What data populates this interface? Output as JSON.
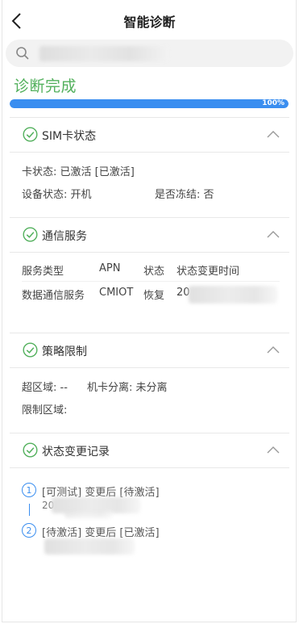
{
  "header": {
    "title": "智能诊断"
  },
  "search": {
    "value": "",
    "placeholder": ""
  },
  "diagnosis": {
    "status": "诊断完成",
    "progress_text": "100%",
    "progress_fraction": 1.0
  },
  "sections": {
    "sim": {
      "title": "SIM卡状态",
      "card_status": "卡状态: 已激活 [已激活]",
      "device_status": "设备状态: 开机",
      "frozen": "是否冻结: 否"
    },
    "comm": {
      "title": "通信服务",
      "columns": [
        "服务类型",
        "APN",
        "状态",
        "状态变更时间"
      ],
      "rows": [
        {
          "service_type": "数据通信服务",
          "apn": "CMIOT",
          "status": "恢复",
          "change_time": "20"
        }
      ]
    },
    "policy": {
      "title": "策略限制",
      "out_of_region": "超区域: --",
      "separation": "机卡分离: 未分离",
      "limit_region": "限制区域:"
    },
    "history": {
      "title": "状态变更记录",
      "steps": [
        {
          "index": "1",
          "text": "[可测试] 变更后 [待激活]",
          "time": "20"
        },
        {
          "index": "2",
          "text": "[待激活] 变更后 [已激活]",
          "time": ""
        }
      ]
    }
  },
  "colors": {
    "accent_green": "#52b05c",
    "accent_blue": "#3a8ef0"
  }
}
